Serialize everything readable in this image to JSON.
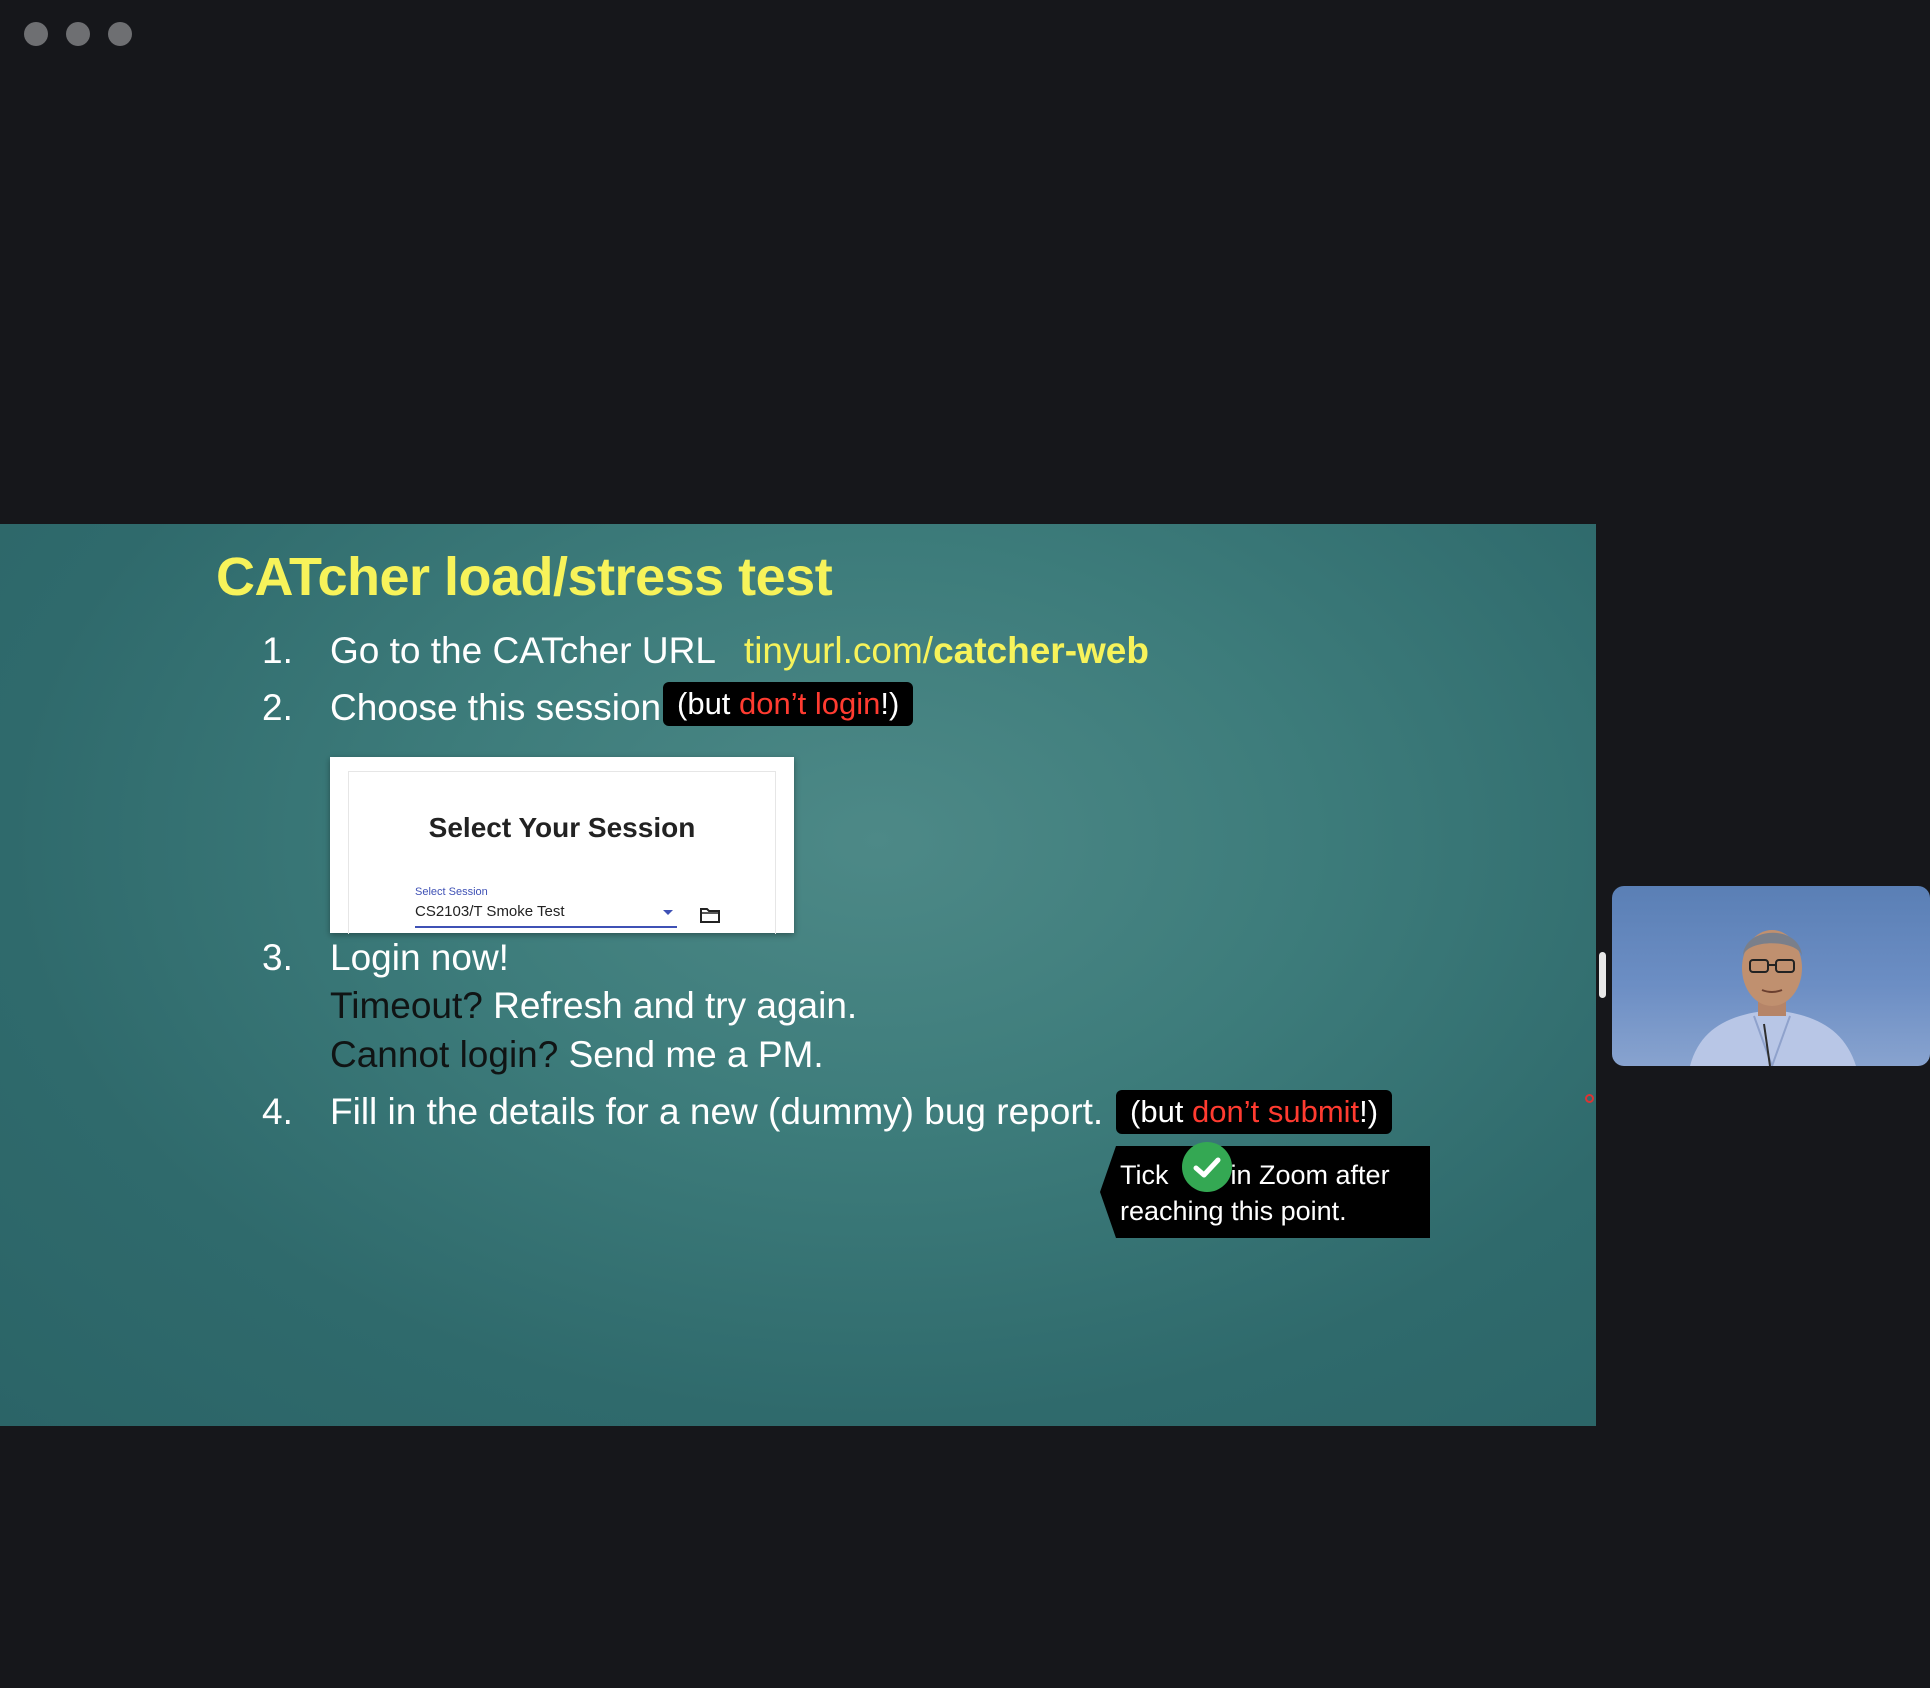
{
  "slide": {
    "title": "CATcher load/stress test",
    "items": [
      {
        "num": "1.",
        "text": "Go to the CATcher URL",
        "url_prefix": "tinyurl.com/",
        "url_path": "catcher-web"
      },
      {
        "num": "2.",
        "text": "Choose this session",
        "callout_open": "(but ",
        "callout_red": "don’t login",
        "callout_close": "!)"
      },
      {
        "num": "3.",
        "line1": "Login now!",
        "line2_label": "Timeout?",
        "line2_text": " Refresh and try again.",
        "line3_label": "Cannot login?",
        "line3_text": " Send me a PM."
      },
      {
        "num": "4.",
        "text": "Fill in the details for a new (dummy) bug report.",
        "callout_open": "(but ",
        "callout_red": "don’t submit",
        "callout_close": "!)"
      }
    ],
    "session_card": {
      "title": "Select Your Session",
      "label": "Select Session",
      "value": "CS2103/T Smoke Test",
      "icon": "folder-icon"
    },
    "tick_note": {
      "before": "Tick",
      "after": "in Zoom after",
      "line2": "reaching this point.",
      "icon": "green-check-icon"
    }
  },
  "video_tile": {
    "description_icon": "participant-video"
  },
  "colors": {
    "title_yellow": "#f7f35a",
    "accent_red": "#ff3b30",
    "background": "#16171b",
    "check_green": "#34a853"
  }
}
